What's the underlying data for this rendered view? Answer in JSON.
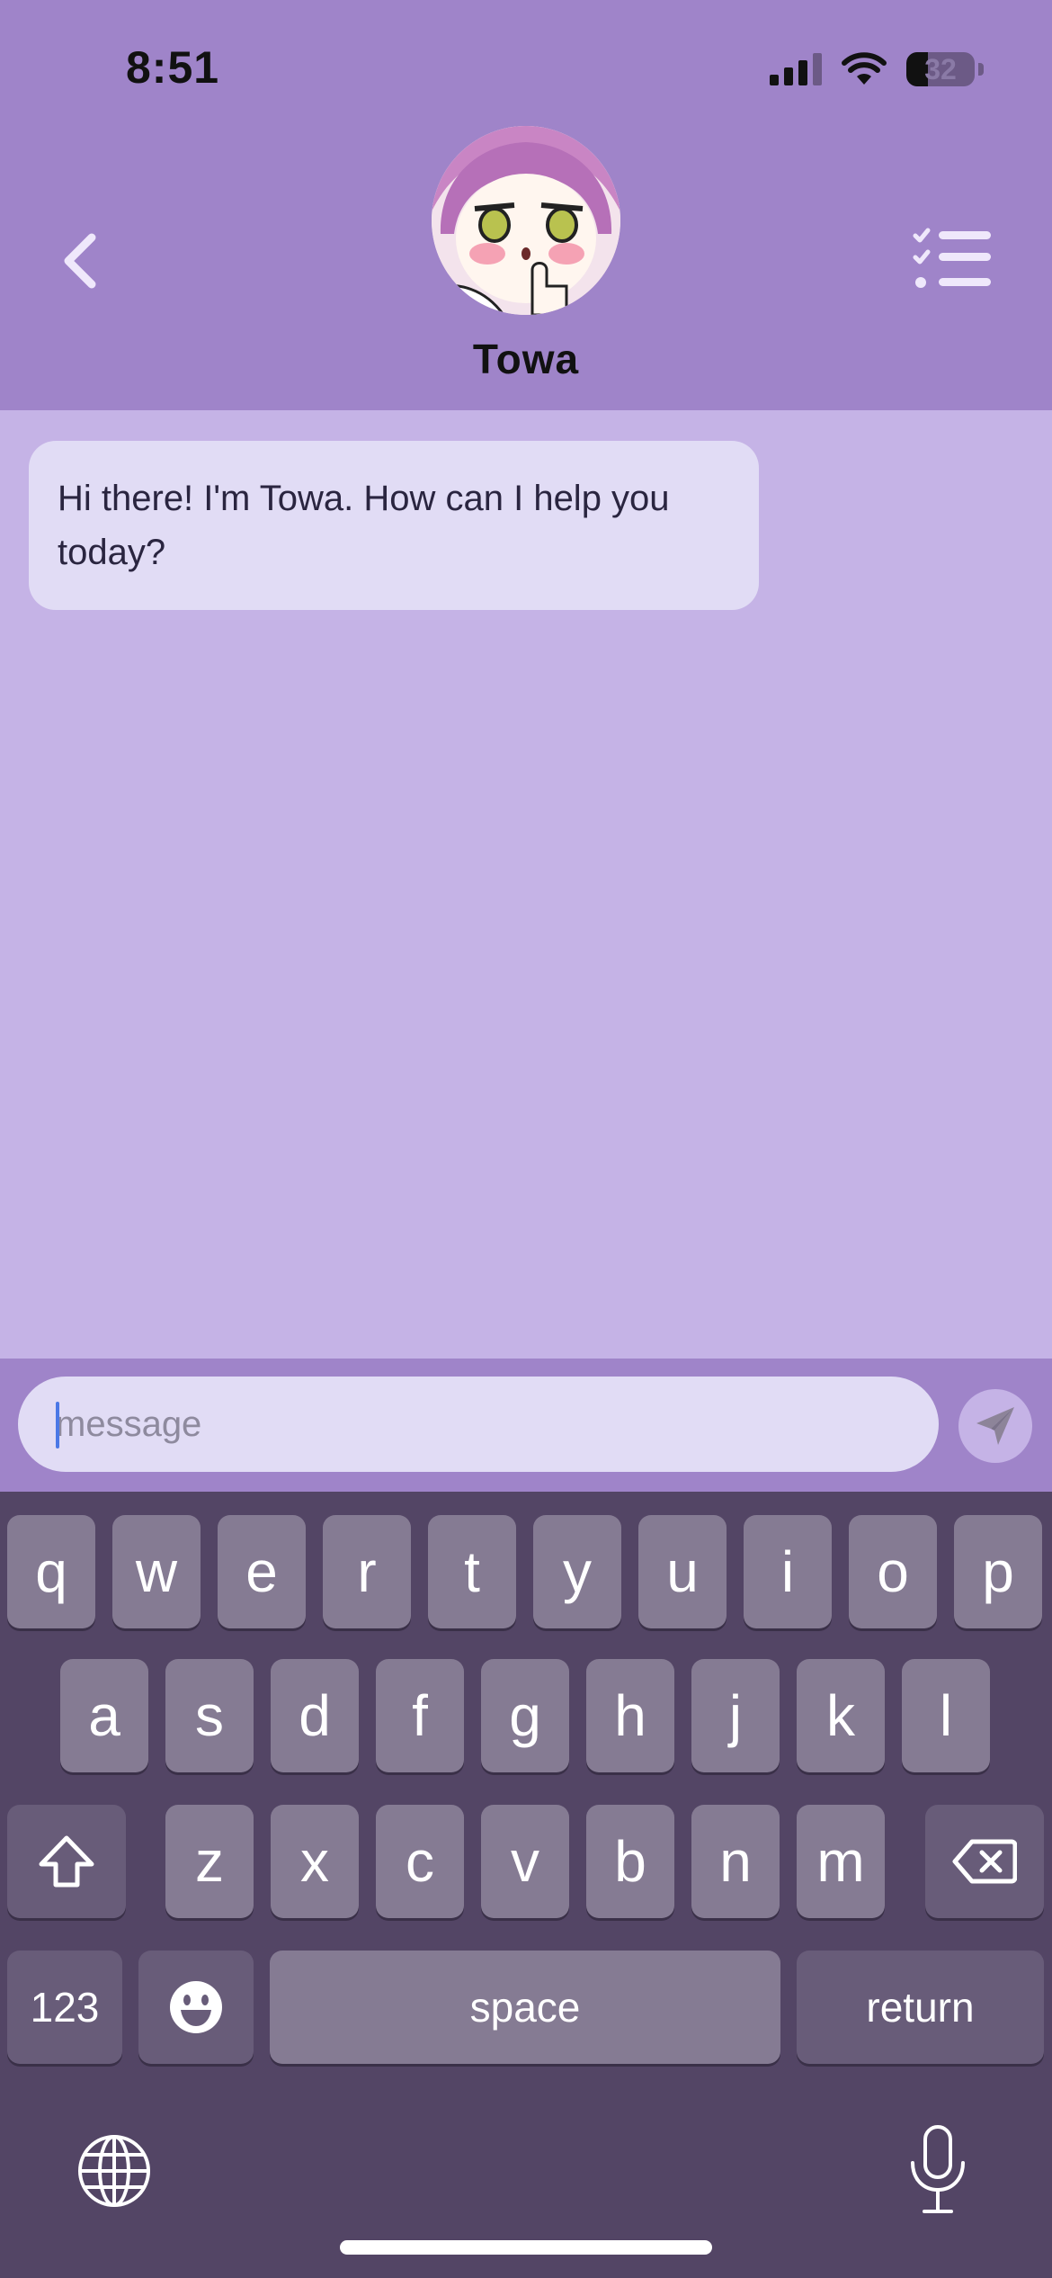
{
  "status_bar": {
    "time": "8:51",
    "battery_level": "32",
    "battery_fraction": 0.32
  },
  "header": {
    "contact_name": "Towa",
    "back_icon": "chevron-left-icon",
    "menu_icon": "checklist-icon"
  },
  "chat": {
    "messages": [
      {
        "sender": "Towa",
        "text": "Hi there! I'm Towa. How can I help you today?"
      }
    ]
  },
  "composer": {
    "placeholder": "message",
    "value": "",
    "send_icon": "paper-plane-icon"
  },
  "keyboard": {
    "row1": [
      "q",
      "w",
      "e",
      "r",
      "t",
      "y",
      "u",
      "i",
      "o",
      "p"
    ],
    "row2": [
      "a",
      "s",
      "d",
      "f",
      "g",
      "h",
      "j",
      "k",
      "l"
    ],
    "row3": [
      "z",
      "x",
      "c",
      "v",
      "b",
      "n",
      "m"
    ],
    "numbers_label": "123",
    "space_label": "space",
    "return_label": "return"
  },
  "colors": {
    "header": "#9f84c9",
    "chat_bg": "#c5b3e6",
    "bubble": "#e1dcf5",
    "keyboard": "#534565",
    "key": "#857b93",
    "key_dark": "#685c79"
  }
}
